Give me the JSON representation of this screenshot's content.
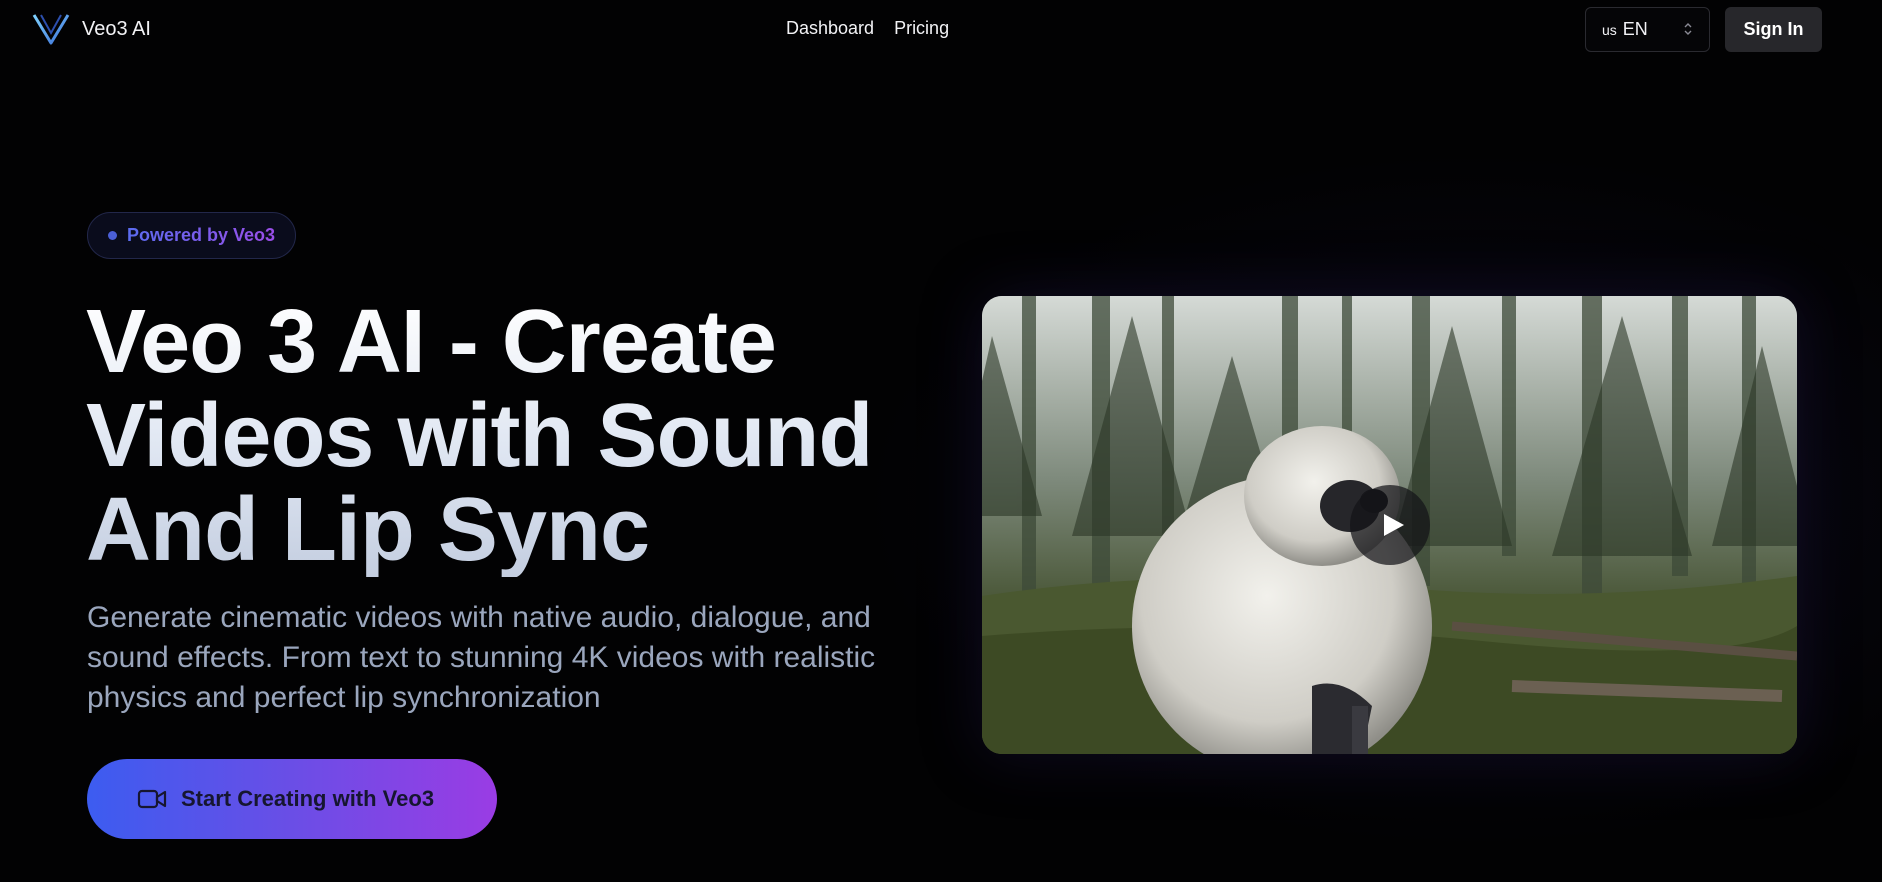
{
  "brand": {
    "name": "Veo3 AI",
    "logo_icon": "v-logo-icon"
  },
  "nav": {
    "items": [
      {
        "label": "Dashboard"
      },
      {
        "label": "Pricing"
      }
    ]
  },
  "language": {
    "flag": "us",
    "code": "EN",
    "icon": "chevron-up-down-icon"
  },
  "header": {
    "signin_label": "Sign In"
  },
  "hero": {
    "badge": "Powered by Veo3",
    "title": "Veo 3 AI - Create Videos with Sound And Lip Sync",
    "subtitle": "Generate cinematic videos with native audio, dialogue, and sound effects. From text to stunning 4K videos with realistic physics and perfect lip synchronization",
    "cta_label": "Start Creating with Veo3",
    "cta_icon": "video-camera-icon"
  },
  "video": {
    "play_icon": "play-icon"
  },
  "colors": {
    "background": "#020203",
    "accent_start": "#3c5cf0",
    "accent_end": "#9a3ce4",
    "subtitle": "#9aa6bd"
  }
}
